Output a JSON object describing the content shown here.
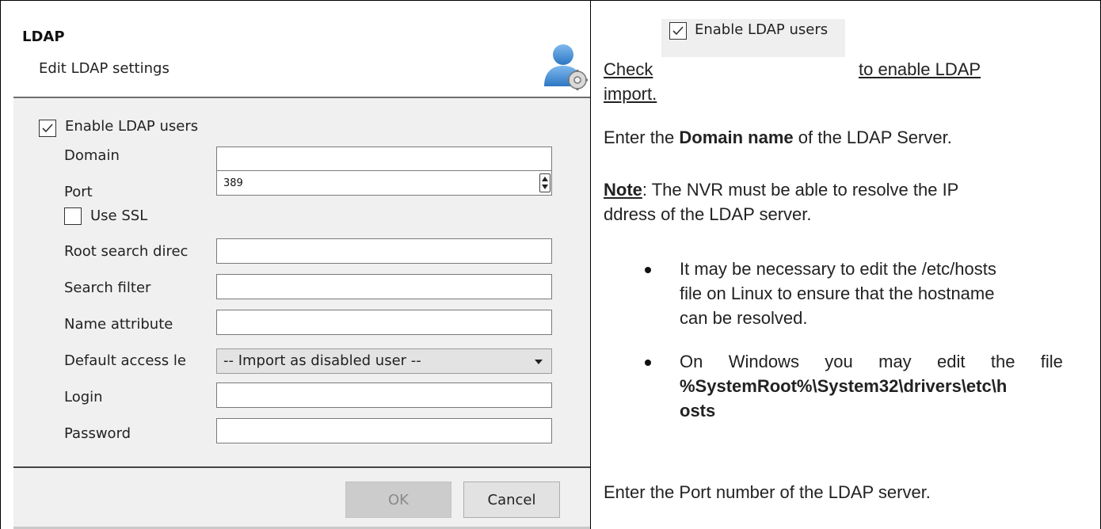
{
  "dialog": {
    "title": "LDAP",
    "subtitle": "Edit LDAP settings",
    "icon": "user-gear-icon",
    "enable_checkbox": {
      "label": "Enable LDAP users",
      "checked": true
    },
    "fields": {
      "domain": {
        "label": "Domain",
        "value": ""
      },
      "port": {
        "label": "Port",
        "value": "389"
      },
      "root_search_directory": {
        "label": "Root search direc",
        "value": ""
      },
      "search_filter": {
        "label": "Search filter",
        "value": ""
      },
      "name_attribute": {
        "label": "Name attribute",
        "value": ""
      },
      "default_access_level": {
        "label": "Default access le",
        "value": "-- Import as disabled user --"
      },
      "login": {
        "label": "Login",
        "value": ""
      },
      "password": {
        "label": "Password",
        "value": ""
      }
    },
    "use_ssl": {
      "label": "Use SSL",
      "checked": false
    },
    "buttons": {
      "ok": "OK",
      "cancel": "Cancel"
    }
  },
  "instructions": {
    "check_prefix": "Check",
    "check_chip_label": "Enable LDAP users",
    "check_suffix": "to enable LDAP",
    "check_suffix_line2": "import.",
    "domain_pre": "Enter the ",
    "domain_bold": "Domain name",
    "domain_post": " of the LDAP Server.",
    "note_label": "Note",
    "note_line1_rest": ": The NVR must be able to resolve the IP",
    "note_line2": "ddress of the LDAP server.",
    "bullet1_lines": [
      "It may be necessary to edit the /etc/hosts",
      "file on Linux to ensure that the hostname",
      "can be resolved."
    ],
    "bullet2_line1_words": [
      "On",
      "Windows",
      "you",
      "may",
      "edit",
      "the",
      "file"
    ],
    "bullet2_bold_line1": "%SystemRoot%\\System32\\drivers\\etc\\h",
    "bullet2_bold_line2": "osts",
    "port_text": "Enter the Port number of the LDAP server."
  },
  "colors": {
    "dialog_bg": "#f0f0f0",
    "header_bg": "#ffffff",
    "ok_disabled_bg": "#cccccc",
    "icon_blue": "#3b8ad6"
  }
}
